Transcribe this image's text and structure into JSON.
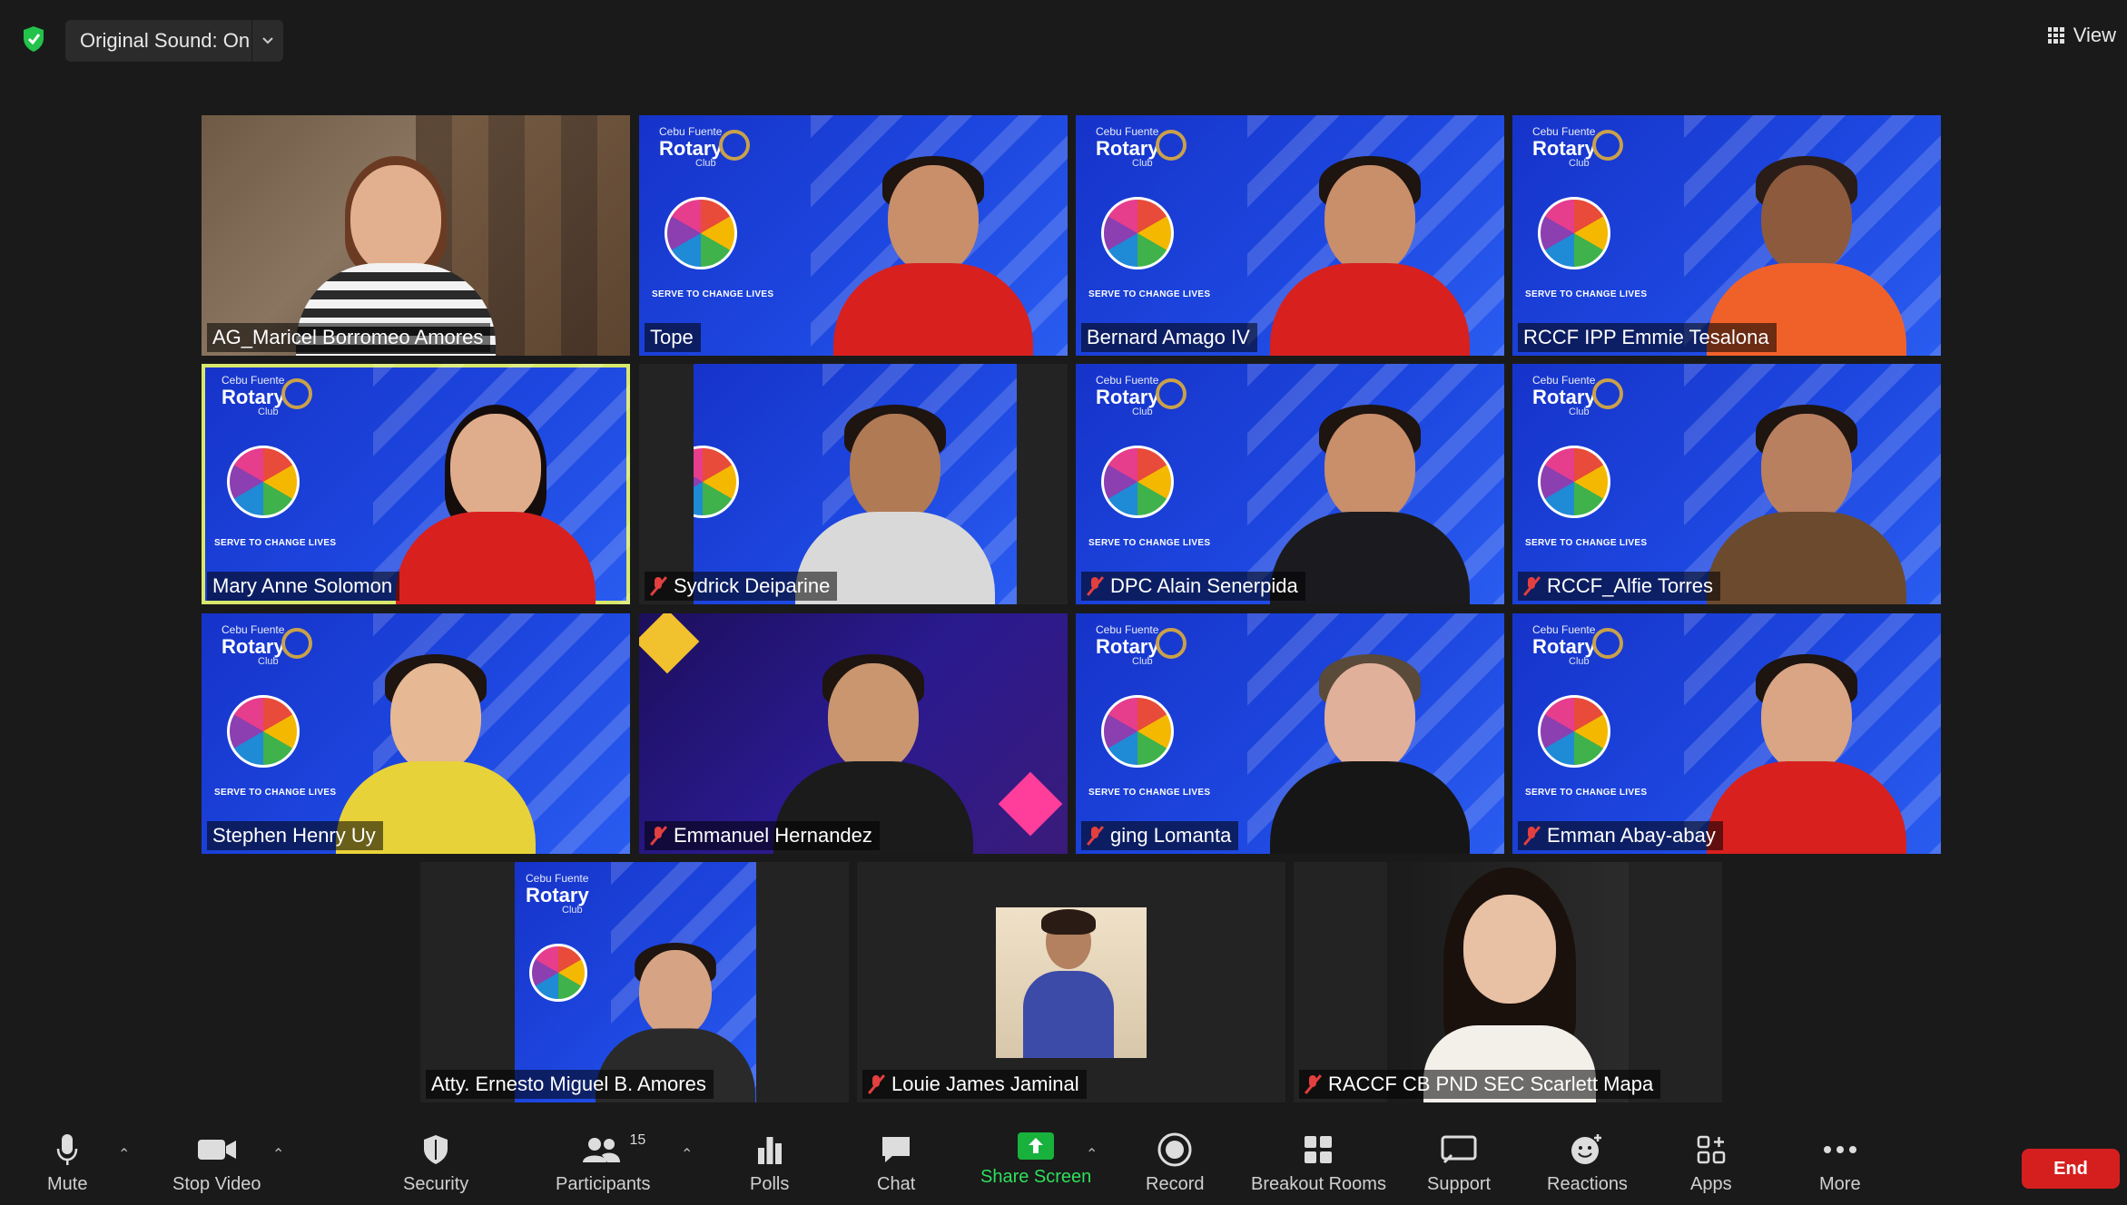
{
  "topbar": {
    "original_sound_label": "Original Sound: On",
    "view_label": "View"
  },
  "participants": [
    {
      "name": "AG_Maricel Borromeo Amores",
      "muted": false
    },
    {
      "name": "Tope",
      "muted": false
    },
    {
      "name": "Bernard Amago IV",
      "muted": false
    },
    {
      "name": "RCCF IPP Emmie Tesalona",
      "muted": false
    },
    {
      "name": "Mary Anne Solomon",
      "muted": false,
      "active_speaker": true
    },
    {
      "name": "Sydrick Deiparine",
      "muted": true
    },
    {
      "name": "DPC Alain Senerpida",
      "muted": true
    },
    {
      "name": "RCCF_Alfie Torres",
      "muted": true
    },
    {
      "name": "Stephen Henry Uy",
      "muted": false
    },
    {
      "name": "Emmanuel Hernandez",
      "muted": true
    },
    {
      "name": "ging Lomanta",
      "muted": true
    },
    {
      "name": "Emman Abay-abay",
      "muted": true
    },
    {
      "name": "Atty. Ernesto Miguel B. Amores",
      "muted": false
    },
    {
      "name": "Louie James Jaminal",
      "muted": true
    },
    {
      "name": "RACCF CB PND SEC Scarlett Mapa",
      "muted": true
    }
  ],
  "brand": {
    "club_top": "Cebu Fuente",
    "club_name": "Rotary",
    "club_bottom": "Club",
    "tagline": "SERVE TO CHANGE LIVES"
  },
  "toolbar": {
    "mute": "Mute",
    "stop_video": "Stop Video",
    "security": "Security",
    "participants": "Participants",
    "participants_count": "15",
    "polls": "Polls",
    "chat": "Chat",
    "share_screen": "Share Screen",
    "record": "Record",
    "breakout_rooms": "Breakout Rooms",
    "support": "Support",
    "reactions": "Reactions",
    "apps": "Apps",
    "more": "More",
    "end": "End"
  },
  "colors": {
    "active_speaker_border": "#d9e86b",
    "share_green": "#18b13c",
    "end_red": "#d51f1f",
    "muted_red": "#e43f3f"
  }
}
